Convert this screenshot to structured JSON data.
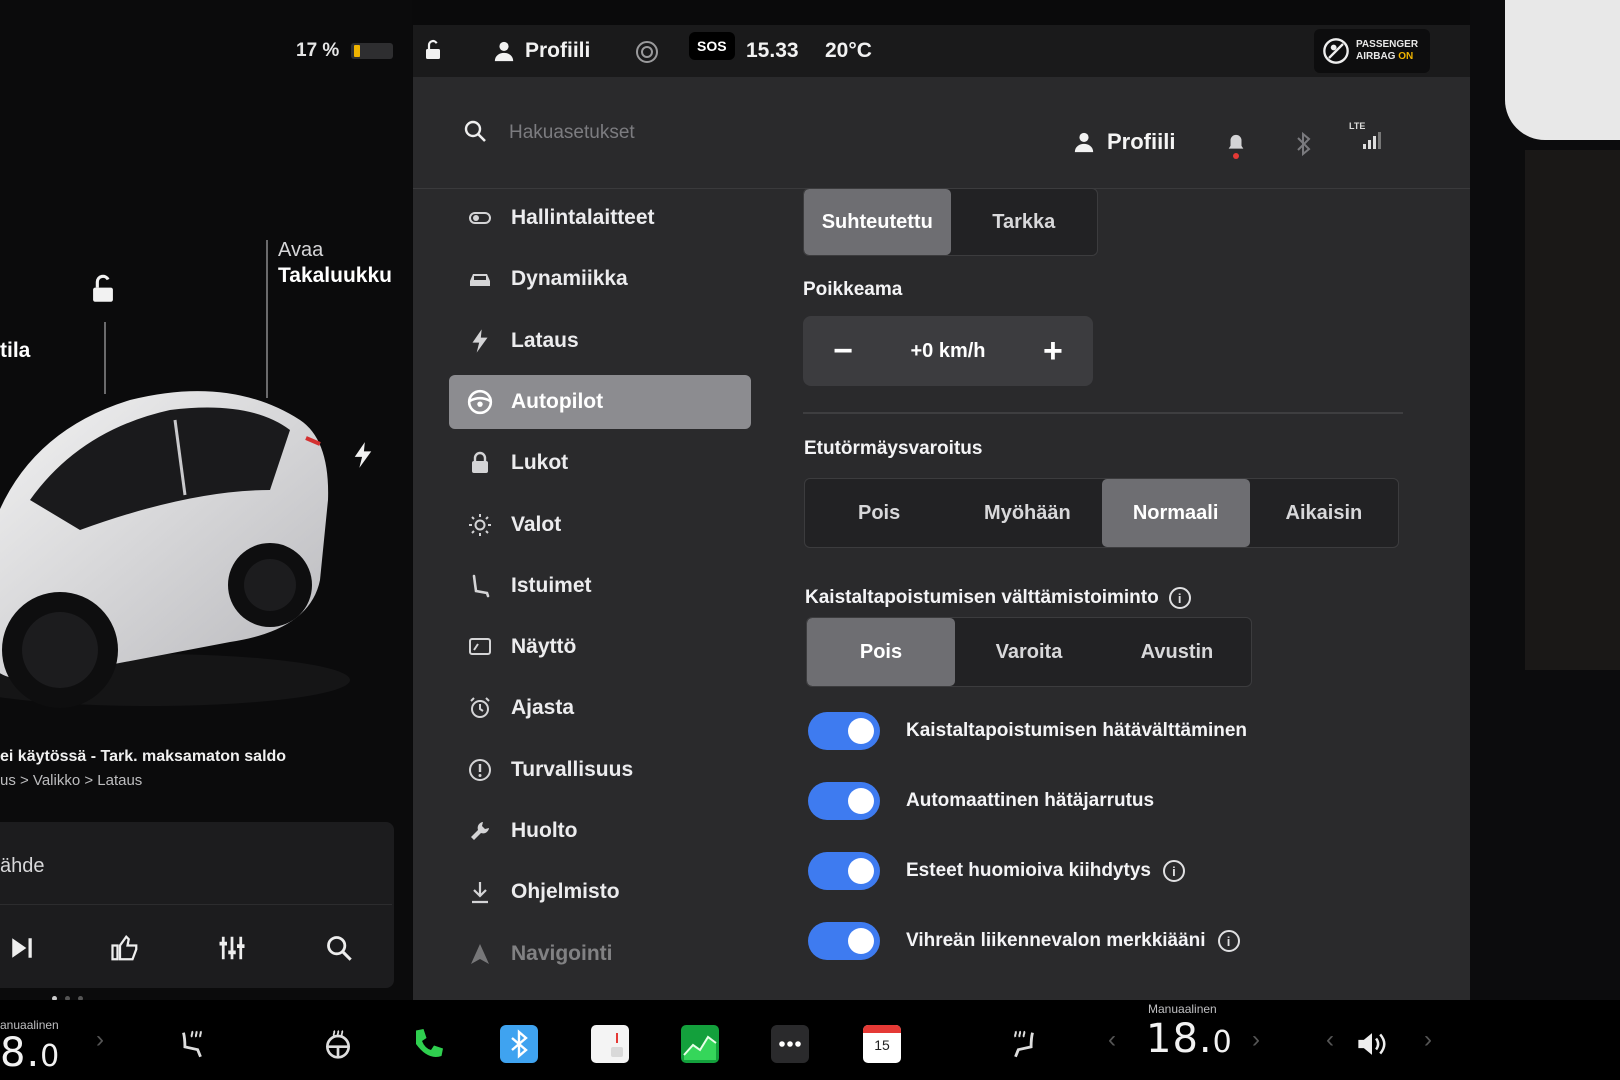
{
  "status": {
    "battery_percent_label": "17 %",
    "battery_level": 0.17,
    "profile_label": "Profiili",
    "sos_label": "SOS",
    "time": "15.33",
    "temperature": "20°C",
    "airbag_line1": "PASSENGER",
    "airbag_line2": "AIRBAG",
    "airbag_state": "ON"
  },
  "car": {
    "side_label_partial": "tila",
    "rear_label_line1": "Avaa",
    "rear_label_line2": "Takaluukku",
    "notice": "ei käytössä - Tark. maksamaton saldo",
    "notice_path": "us > Valikko > Lataus",
    "media_source": "ähde"
  },
  "search": {
    "placeholder": "Hakuasetukset"
  },
  "header": {
    "profile_label": "Profiili",
    "network_label": "LTE"
  },
  "sidebar": {
    "items": [
      {
        "label": "Hallintalaitteet",
        "icon": "toggle-icon"
      },
      {
        "label": "Dynamiikka",
        "icon": "car-icon"
      },
      {
        "label": "Lataus",
        "icon": "bolt-icon"
      },
      {
        "label": "Autopilot",
        "icon": "steering-wheel-icon",
        "active": true
      },
      {
        "label": "Lukot",
        "icon": "lock-icon"
      },
      {
        "label": "Valot",
        "icon": "sun-icon"
      },
      {
        "label": "Istuimet",
        "icon": "seat-icon"
      },
      {
        "label": "Näyttö",
        "icon": "display-icon"
      },
      {
        "label": "Ajasta",
        "icon": "alarm-clock-icon"
      },
      {
        "label": "Turvallisuus",
        "icon": "alert-circle-icon"
      },
      {
        "label": "Huolto",
        "icon": "wrench-icon"
      },
      {
        "label": "Ohjelmisto",
        "icon": "download-icon"
      },
      {
        "label": "Navigointi",
        "icon": "navigation-icon"
      }
    ]
  },
  "speed_mode": {
    "options": [
      "Suhteutettu",
      "Tarkka"
    ],
    "selected": "Suhteutettu"
  },
  "offset": {
    "title": "Poikkeama",
    "value": "+0 km/h",
    "minus": "−",
    "plus": "+"
  },
  "forward_collision": {
    "title": "Etutörmäysvaroitus",
    "options": [
      "Pois",
      "Myöhään",
      "Normaali",
      "Aikaisin"
    ],
    "selected": "Normaali"
  },
  "lane_departure": {
    "title": "Kaistaltapoistumisen välttämistoiminto",
    "options": [
      "Pois",
      "Varoita",
      "Avustin"
    ],
    "selected": "Pois"
  },
  "toggles": [
    {
      "label": "Kaistaltapoistumisen hätävälttäminen",
      "on": true,
      "info": false
    },
    {
      "label": "Automaattinen hätäjarrutus",
      "on": true,
      "info": false
    },
    {
      "label": "Esteet huomioiva kiihdytys",
      "on": true,
      "info": true
    },
    {
      "label": "Vihreän liikennevalon merkkiääni",
      "on": true,
      "info": true
    }
  ],
  "dock": {
    "left_temp_label": "anuaalinen",
    "left_temp": "8.",
    "left_temp_decimal": "0",
    "right_temp_label": "Manuaalinen",
    "right_temp": "18.",
    "right_temp_decimal": "0",
    "calendar_day": "15"
  },
  "colors": {
    "accent_blue": "#3e7bf0",
    "panel_bg": "#2a2a2c",
    "selected_segment": "#6e6e72",
    "sidebar_active": "#8c8c90",
    "airbag_on": "#f0b400"
  }
}
